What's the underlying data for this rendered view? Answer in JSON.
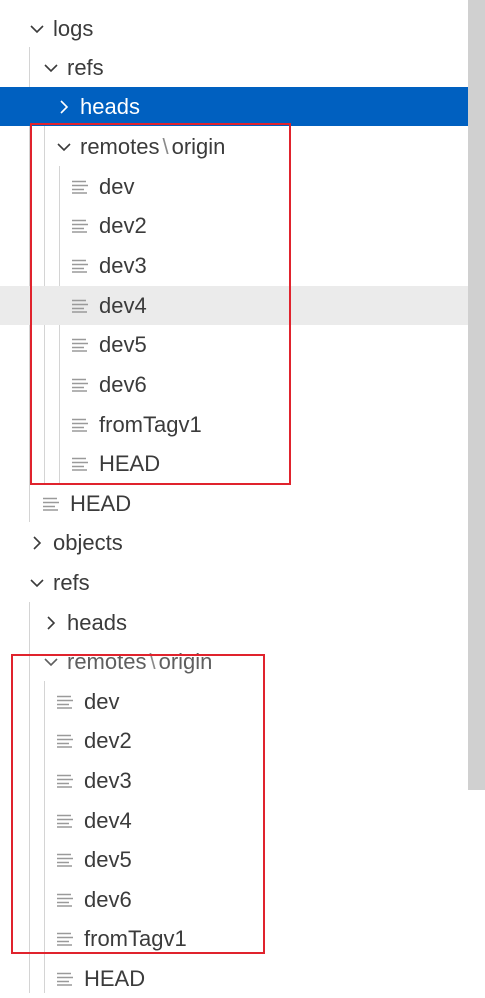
{
  "tree": {
    "logs_label": "logs",
    "logs_refs_label": "refs",
    "logs_heads_label": "heads",
    "logs_remotes": {
      "remotes": "remotes",
      "separator": "\\",
      "origin": "origin"
    },
    "logs_files": [
      "dev",
      "dev2",
      "dev3",
      "dev4",
      "dev5",
      "dev6",
      "fromTagv1",
      "HEAD"
    ],
    "logs_head_label": "HEAD",
    "objects_label": "objects",
    "refs_label": "refs",
    "refs_heads_label": "heads",
    "refs_remotes": {
      "remotes": "remotes",
      "separator": "\\",
      "origin": "origin"
    },
    "refs_files": [
      "dev",
      "dev2",
      "dev3",
      "dev4",
      "dev5",
      "dev6",
      "fromTagv1",
      "HEAD"
    ]
  },
  "icons": {
    "expanded": "chevron-down-icon",
    "collapsed": "chevron-right-icon",
    "file": "file-lines-icon"
  },
  "colors": {
    "selection": "#0060c0",
    "highlight_box": "#e0232d",
    "hover_row": "#ebebeb"
  }
}
